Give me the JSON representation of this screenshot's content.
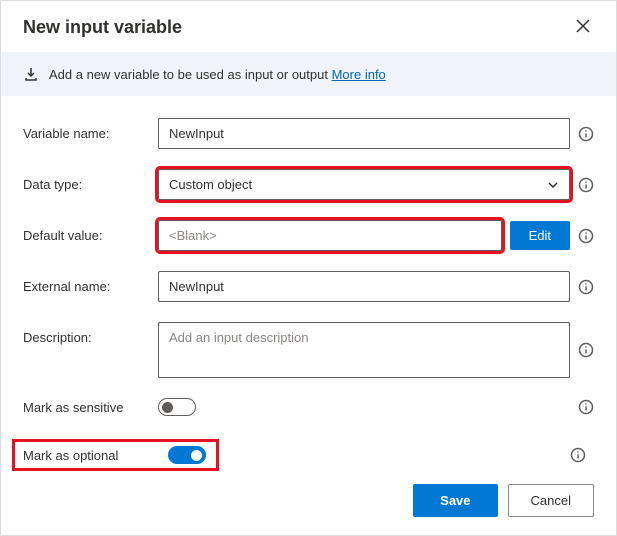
{
  "dialog": {
    "title": "New input variable"
  },
  "banner": {
    "text": "Add a new variable to be used as input or output ",
    "link": "More info"
  },
  "form": {
    "variable_name": {
      "label": "Variable name:",
      "value": "NewInput"
    },
    "data_type": {
      "label": "Data type:",
      "value": "Custom object"
    },
    "default_value": {
      "label": "Default value:",
      "value": "<Blank>",
      "edit": "Edit"
    },
    "external_name": {
      "label": "External name:",
      "value": "NewInput"
    },
    "description": {
      "label": "Description:",
      "placeholder": "Add an input description",
      "value": ""
    },
    "mark_sensitive": {
      "label": "Mark as sensitive",
      "on": false
    },
    "mark_optional": {
      "label": "Mark as optional",
      "on": true
    }
  },
  "footer": {
    "save": "Save",
    "cancel": "Cancel"
  }
}
